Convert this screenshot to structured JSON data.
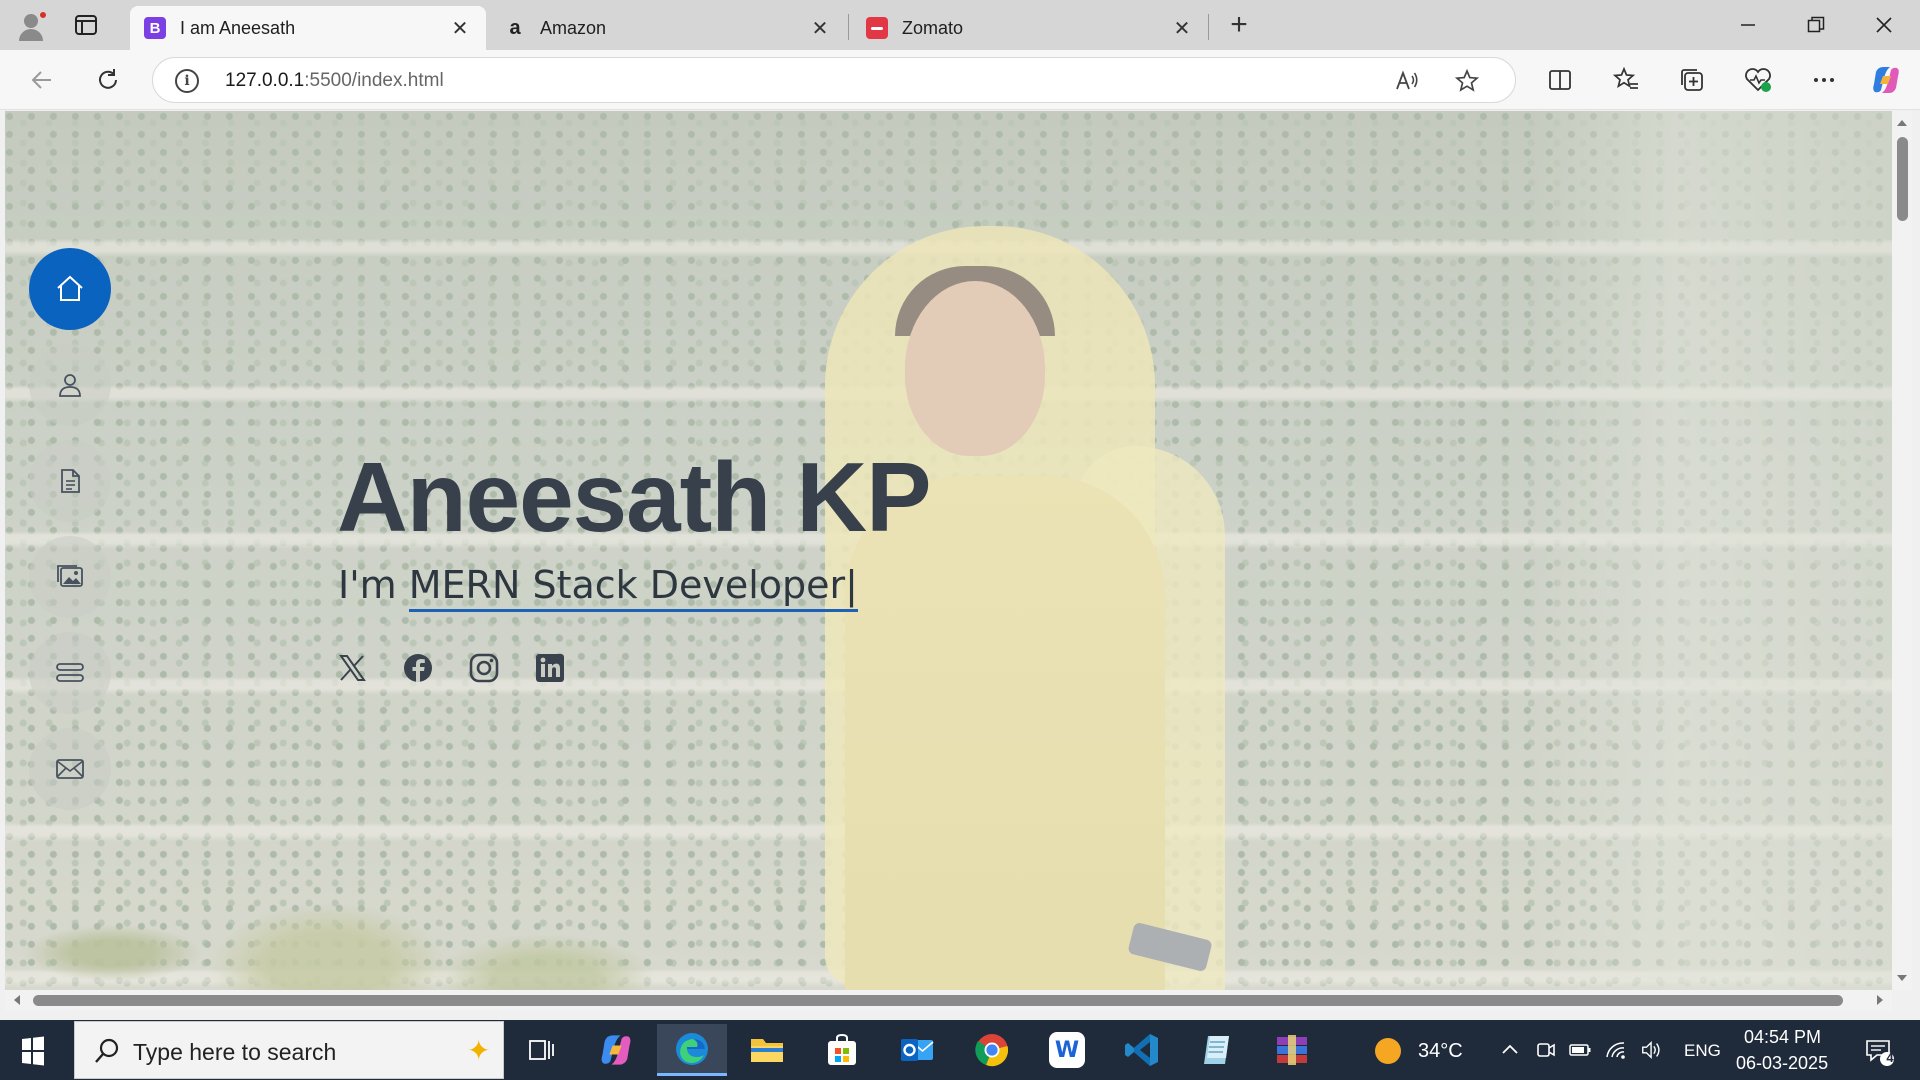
{
  "browser": {
    "tabs": [
      {
        "favicon": "B",
        "favicon_color": "#7b3fe4",
        "title": "I am Aneesath",
        "active": true
      },
      {
        "favicon": "a",
        "favicon_color": "#222222",
        "title": "Amazon",
        "active": false
      },
      {
        "favicon": "",
        "favicon_color": "#e23744",
        "title": "Zomato",
        "active": false
      }
    ],
    "address": {
      "host": "127.0.0.1",
      "rest": ":5500/index.html"
    }
  },
  "page": {
    "name": "Aneesath KP",
    "subtitle_prefix": "I'm ",
    "subtitle_typed": "MERN Stack Developer|",
    "nav": [
      "home-icon",
      "person-icon",
      "document-icon",
      "images-icon",
      "services-icon",
      "envelope-icon"
    ],
    "social": [
      "x-twitter-icon",
      "facebook-icon",
      "instagram-icon",
      "linkedin-icon"
    ],
    "accent_color": "#0b63c0"
  },
  "taskbar": {
    "search_placeholder": "Type here to search",
    "weather": "34°C",
    "language": "ENG",
    "time": "04:54 PM",
    "date": "06-03-2025",
    "notification_count": "4"
  }
}
